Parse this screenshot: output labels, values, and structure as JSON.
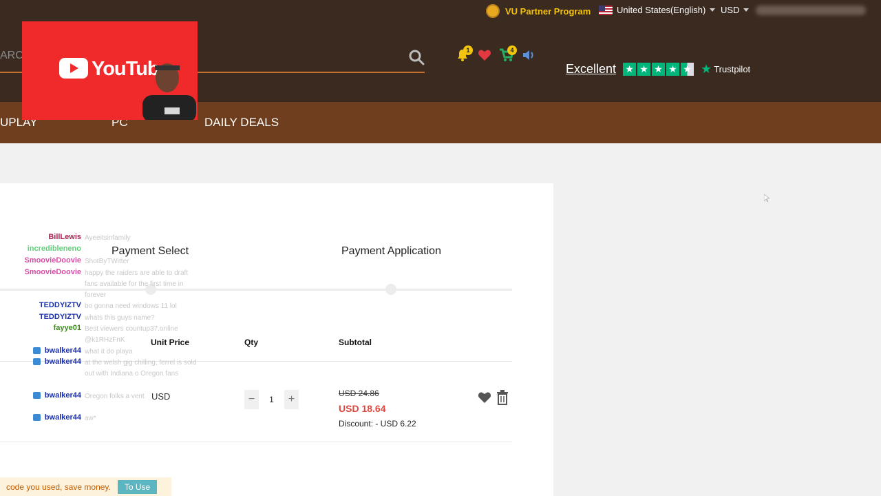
{
  "header": {
    "partner_label": "VU Partner Program",
    "region_label": "United States(English)",
    "currency_label": "USD",
    "search_fragment": "ARC",
    "notif_count": "1",
    "cart_count": "4",
    "trust_rating": "Excellent",
    "trust_brand": "Trustpilot",
    "trust_stars": 4.5
  },
  "nav": {
    "items": [
      "UPLAY",
      "PC",
      "DAILY DEALS"
    ]
  },
  "overlay": {
    "youtube_label": "YouTube"
  },
  "checkout": {
    "steps": [
      "Payment Select",
      "Payment Application"
    ],
    "columns": [
      "Unit Price",
      "Qty",
      "Subtotal"
    ],
    "item": {
      "unit_price": "USD",
      "quantity": "1",
      "original_price": "USD 24.86",
      "sale_price": "USD 18.64",
      "discount": "Discount: - USD 6.22"
    }
  },
  "chat": [
    {
      "name": "BillLewis",
      "text": "Ayeeitsinfamily",
      "color": "#b22255"
    },
    {
      "name": "incredibleneno",
      "text": "",
      "color": "#5fd17a"
    },
    {
      "name": "SmoovieDoovie",
      "text": "ShotByTWitter",
      "color": "#d64fa5"
    },
    {
      "name": "SmoovieDoovie",
      "text": "happy the raiders are able to draft fans available for the first time in forever",
      "color": "#d64fa5"
    },
    {
      "name": "TEDDYIZTV",
      "text": "bo gonna need windows 11 lol",
      "color": "#1a2ea8"
    },
    {
      "name": "TEDDYIZTV",
      "text": "whats this guys name?",
      "color": "#1a2ea8"
    },
    {
      "name": "fayye01",
      "text": "Best viewers countup37.online @k1RHzFnK",
      "color": "#3c8a1c"
    },
    {
      "name": "bwalker44",
      "text": "what it do playa",
      "color": "#1a2ea8"
    },
    {
      "name": "bwalker44",
      "text": "at the welsh gig chilling, ferrel is sold out with Indiana o Oregon fans",
      "color": "#1a2ea8"
    },
    {
      "name": "bwalker44",
      "text": "Oregon folks a vent",
      "color": "#1a2ea8"
    },
    {
      "name": "bwalker44",
      "text": "aw*",
      "color": "#1a2ea8"
    }
  ],
  "coupon": {
    "text": "code you used, save money.",
    "button": "To Use"
  },
  "colors": {
    "header_bg": "#3a2a20",
    "nav_bg": "#6e3e1e",
    "accent": "#c8712a",
    "sale_price": "#e0463f",
    "trustpilot": "#00b67a"
  }
}
